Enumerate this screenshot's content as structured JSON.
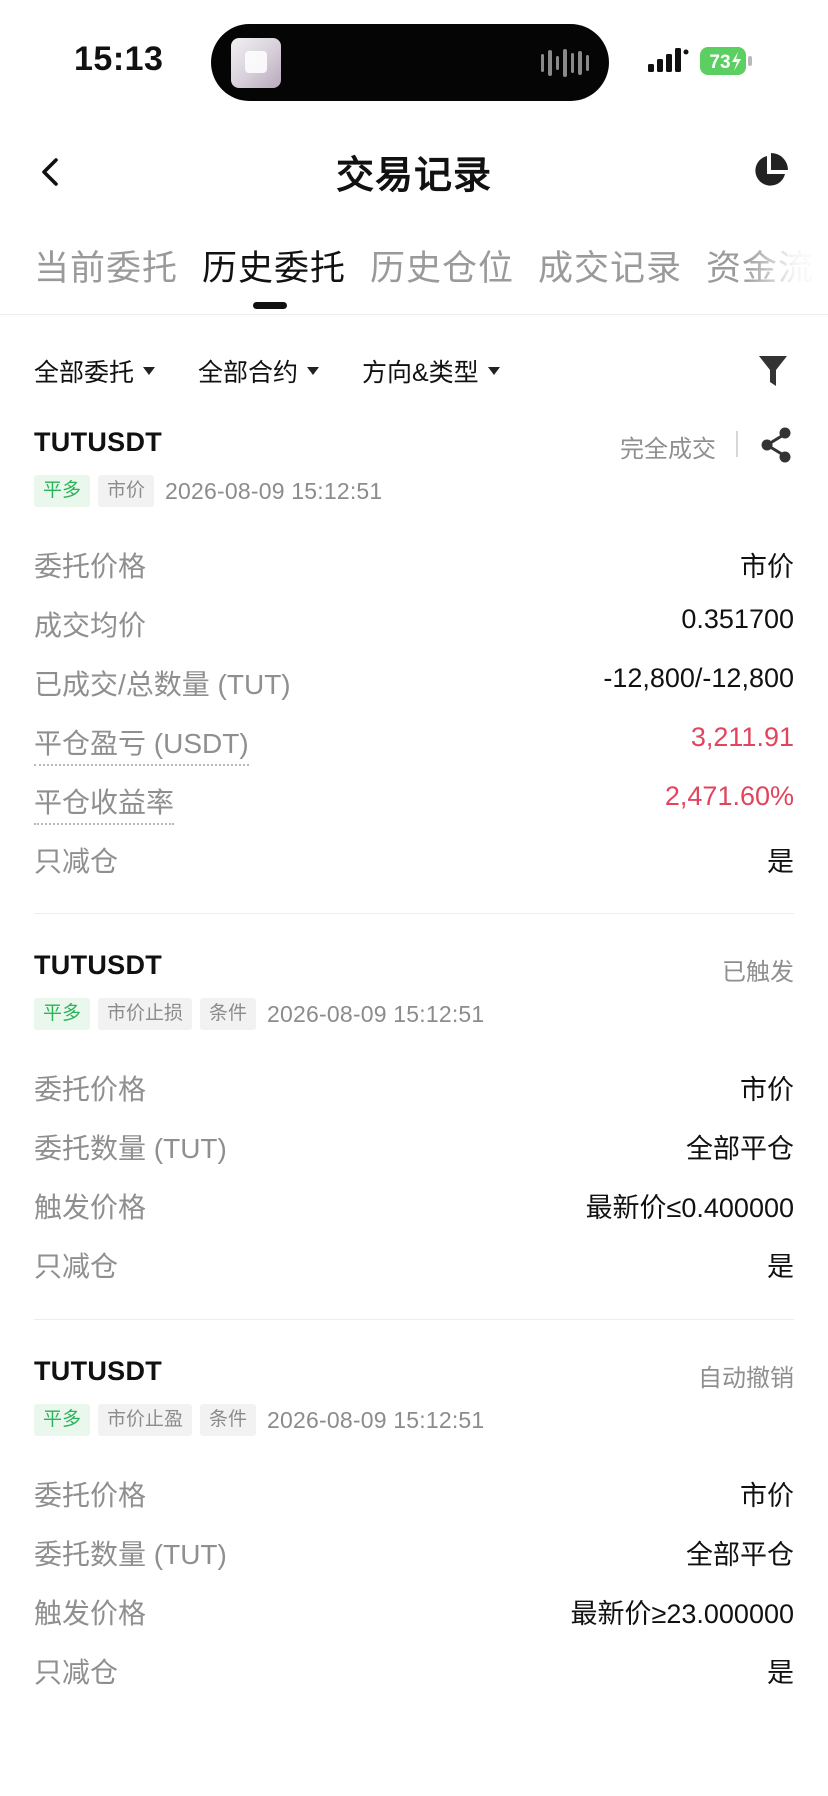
{
  "status_bar": {
    "time": "15:13",
    "battery": "73"
  },
  "header": {
    "title": "交易记录",
    "back_icon": "chevron-left-icon",
    "right_icon": "pie-chart-icon"
  },
  "tabs": [
    {
      "label": "当前委托",
      "active": false
    },
    {
      "label": "历史委托",
      "active": true
    },
    {
      "label": "历史仓位",
      "active": false
    },
    {
      "label": "成交记录",
      "active": false
    },
    {
      "label": "资金流",
      "active": false
    }
  ],
  "filters": [
    {
      "label": "全部委托"
    },
    {
      "label": "全部合约"
    },
    {
      "label": "方向&类型"
    }
  ],
  "colors": {
    "profit_red": "#e0455d",
    "long_green": "#2db35a",
    "muted": "#8f8f8f"
  },
  "orders": [
    {
      "symbol": "TUTUSDT",
      "status": "完全成交",
      "tags": [
        "平多",
        "市价"
      ],
      "time": "2026-08-09 15:12:51",
      "rows": [
        {
          "label": "委托价格",
          "value": "市价"
        },
        {
          "label": "成交均价",
          "value": "0.351700"
        },
        {
          "label": "已成交/总数量 (TUT)",
          "value": "-12,800/-12,800"
        },
        {
          "label": "平仓盈亏 (USDT)",
          "value": "3,211.91"
        },
        {
          "label": "平仓收益率",
          "value": "2,471.60%"
        },
        {
          "label": "只减仓",
          "value": "是"
        }
      ]
    },
    {
      "symbol": "TUTUSDT",
      "status": "已触发",
      "tags": [
        "平多",
        "市价止损",
        "条件"
      ],
      "time": "2026-08-09 15:12:51",
      "rows": [
        {
          "label": "委托价格",
          "value": "市价"
        },
        {
          "label": "委托数量 (TUT)",
          "value": "全部平仓"
        },
        {
          "label": "触发价格",
          "value": "最新价≤0.400000"
        },
        {
          "label": "只减仓",
          "value": "是"
        }
      ]
    },
    {
      "symbol": "TUTUSDT",
      "status": "自动撤销",
      "tags": [
        "平多",
        "市价止盈",
        "条件"
      ],
      "time": "2026-08-09 15:12:51",
      "rows": [
        {
          "label": "委托价格",
          "value": "市价"
        },
        {
          "label": "委托数量 (TUT)",
          "value": "全部平仓"
        },
        {
          "label": "触发价格",
          "value": "最新价≥23.000000"
        },
        {
          "label": "只减仓",
          "value": "是"
        }
      ]
    }
  ]
}
